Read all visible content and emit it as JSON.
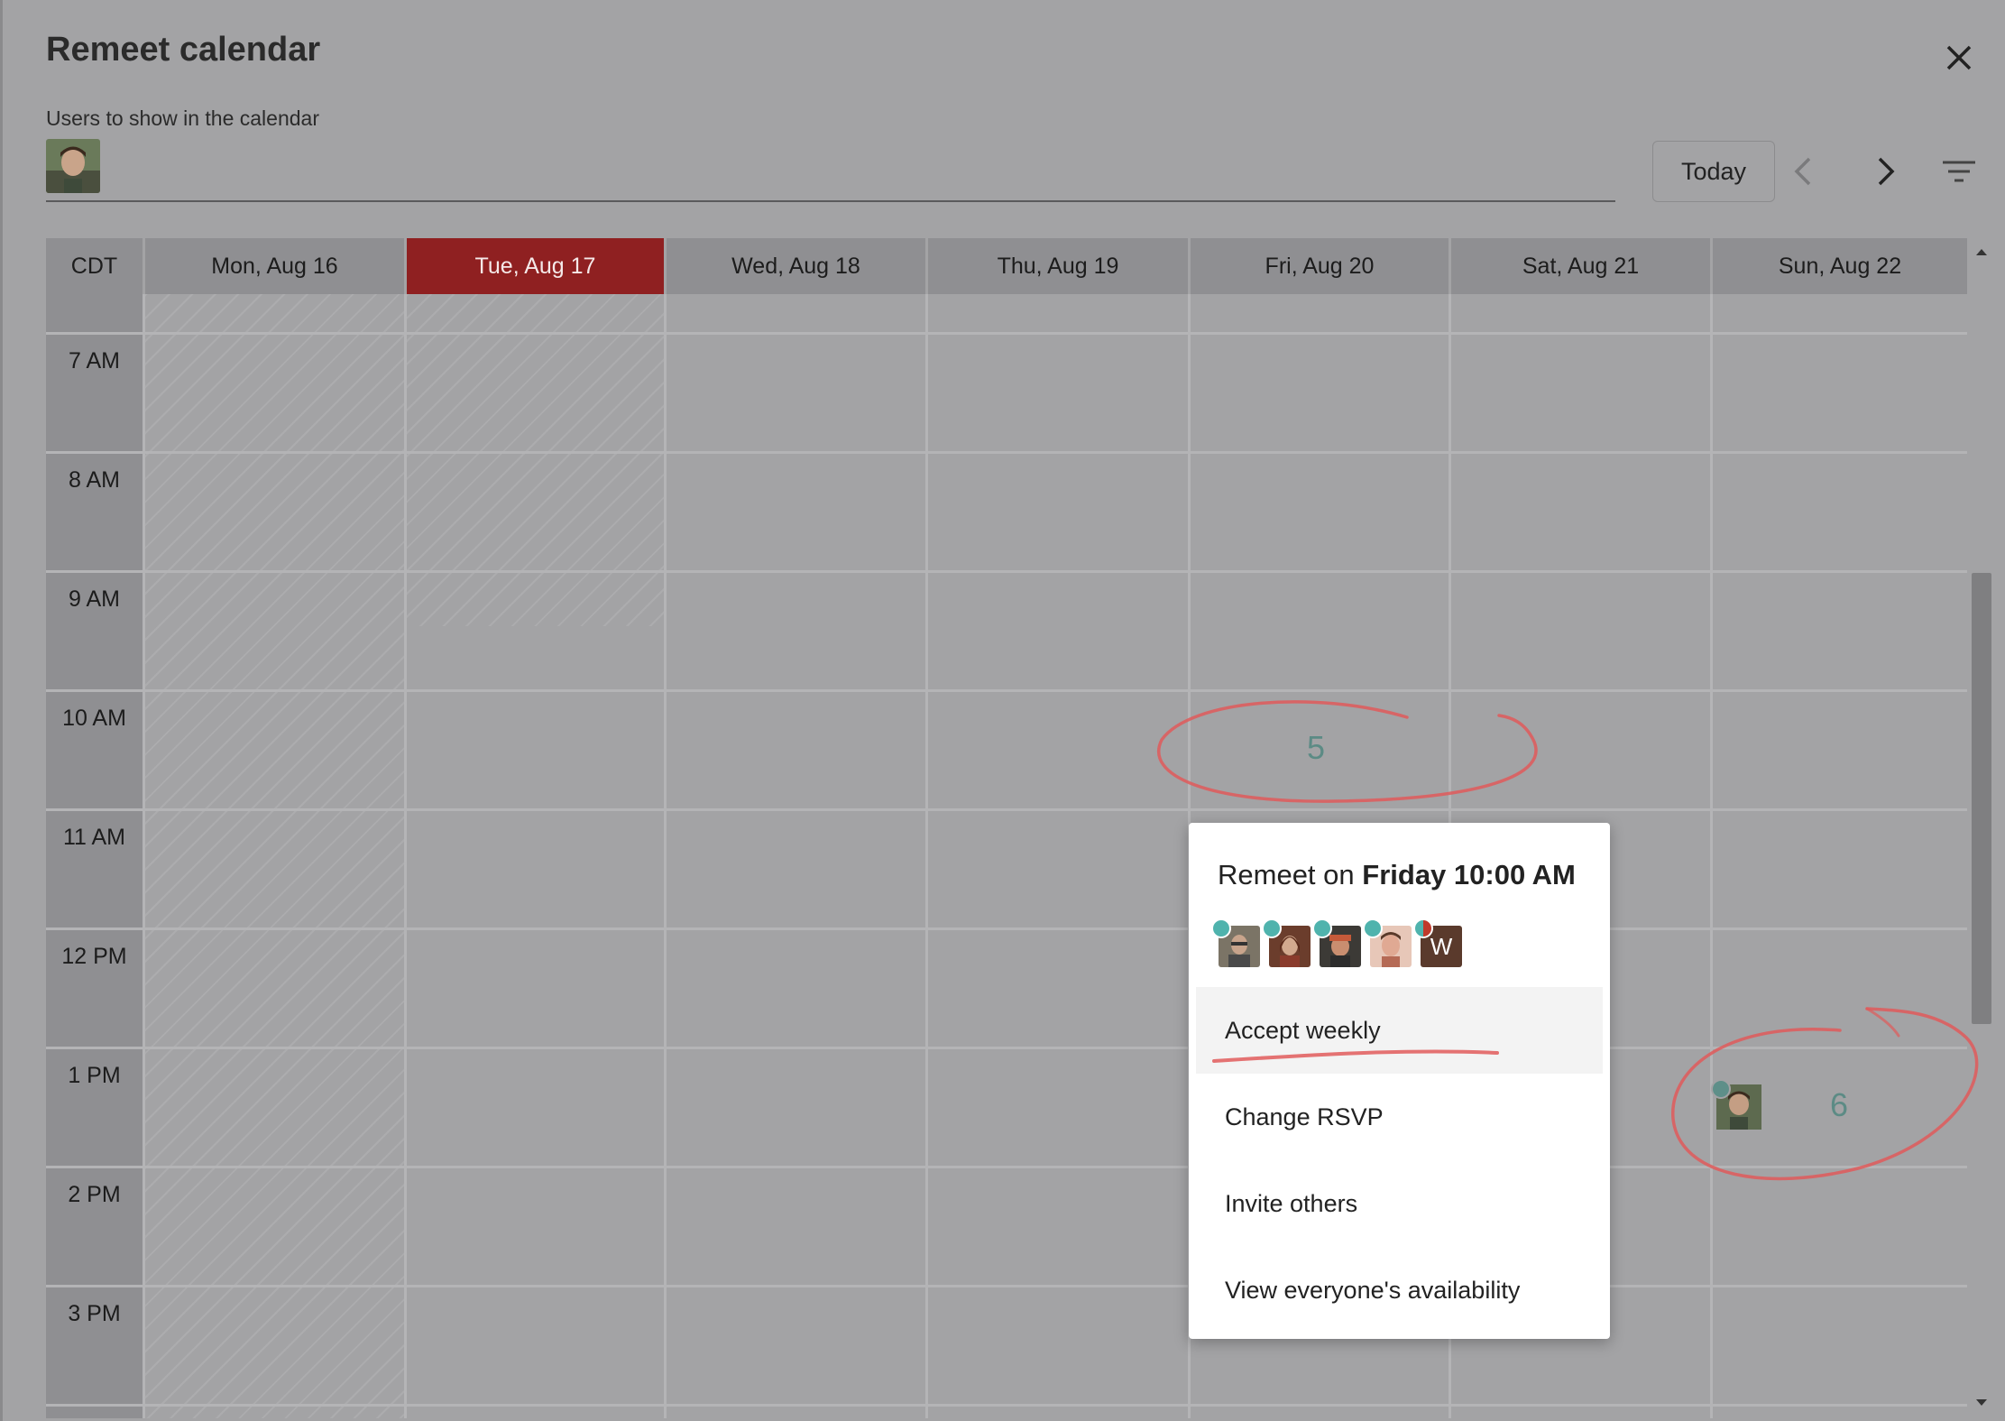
{
  "dialog": {
    "title": "Remeet calendar",
    "users_label": "Users to show in the calendar"
  },
  "toolbar": {
    "today_label": "Today"
  },
  "calendar": {
    "timezone": "CDT",
    "days": [
      {
        "label": "Mon, Aug 16",
        "is_today": false
      },
      {
        "label": "Tue, Aug 17",
        "is_today": true
      },
      {
        "label": "Wed, Aug 18",
        "is_today": false
      },
      {
        "label": "Thu, Aug 19",
        "is_today": false
      },
      {
        "label": "Fri, Aug 20",
        "is_today": false
      },
      {
        "label": "Sat, Aug 21",
        "is_today": false
      },
      {
        "label": "Sun, Aug 22",
        "is_today": false
      }
    ],
    "hours": [
      "7 AM",
      "8 AM",
      "9 AM",
      "10 AM",
      "11 AM",
      "12 PM",
      "1 PM",
      "2 PM",
      "3 PM"
    ],
    "slots": [
      {
        "day": "Fri, Aug 20",
        "hour": "10 AM",
        "count": "5"
      },
      {
        "day": "Sun, Aug 22",
        "hour": "1 PM",
        "count": "6"
      }
    ]
  },
  "popup": {
    "title_prefix": "Remeet on ",
    "title_time": "Friday 10:00 AM",
    "avatar_initial": "W",
    "menu": {
      "accept_weekly": "Accept weekly",
      "change_rsvp": "Change RSVP",
      "invite_others": "Invite others",
      "view_availability": "View everyone's availability"
    }
  },
  "colors": {
    "today_header": "#8f2021",
    "accepted_dot": "#4fb3ad",
    "annotation": "#e05a5a"
  }
}
